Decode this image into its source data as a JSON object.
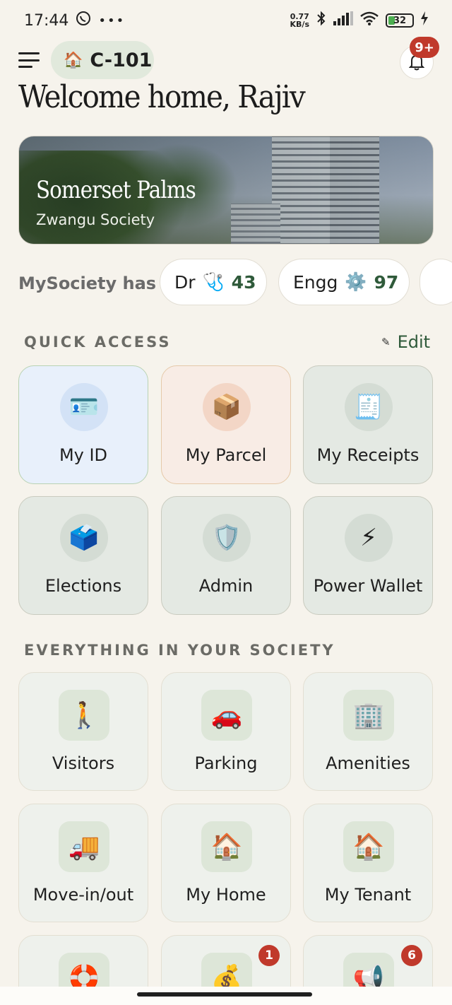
{
  "status_bar": {
    "time": "17:44",
    "left_icons": [
      "whatsapp-icon",
      "more-icon"
    ],
    "net_speed_value": "0.77",
    "net_speed_unit": "KB/s",
    "battery": "32"
  },
  "header": {
    "unit_label": "C-101",
    "notification_badge": "9+",
    "welcome": "Welcome home, Rajiv"
  },
  "hero": {
    "title": "Somerset Palms",
    "subtitle": "Zwangu Society"
  },
  "professionals": {
    "label": "MySociety has",
    "chips": [
      {
        "name": "Dr",
        "icon": "🩺",
        "count": "43"
      },
      {
        "name": "Engg",
        "icon": "⚙️",
        "count": "97"
      }
    ]
  },
  "quick_access": {
    "title": "QUICK ACCESS",
    "edit_label": "Edit",
    "tiles": [
      {
        "label": "My ID",
        "icon": "🪪"
      },
      {
        "label": "My Parcel",
        "icon": "📦"
      },
      {
        "label": "My Receipts",
        "icon": "🧾"
      },
      {
        "label": "Elections",
        "icon": "🗳️"
      },
      {
        "label": "Admin",
        "icon": "🛡️"
      },
      {
        "label": "Power Wallet",
        "icon": "⚡"
      }
    ]
  },
  "society": {
    "title": "EVERYTHING IN YOUR SOCIETY",
    "tiles": [
      {
        "label": "Visitors",
        "icon": "🚶"
      },
      {
        "label": "Parking",
        "icon": "🚗"
      },
      {
        "label": "Amenities",
        "icon": "🏢"
      },
      {
        "label": "Move-in/out",
        "icon": "🚚"
      },
      {
        "label": "My Home",
        "icon": "🏠"
      },
      {
        "label": "My Tenant",
        "icon": "🏠"
      },
      {
        "label": "",
        "icon": "🛟"
      },
      {
        "label": "",
        "icon": "💰",
        "badge": "1"
      },
      {
        "label": "",
        "icon": "📢",
        "badge": "6"
      }
    ]
  },
  "colors": {
    "background": "#f6f3ec",
    "accent_green": "#2f5a3a",
    "badge_red": "#c0392b",
    "my_id_tile": "#e8f0fb",
    "my_parcel_tile": "#f8ece5"
  }
}
